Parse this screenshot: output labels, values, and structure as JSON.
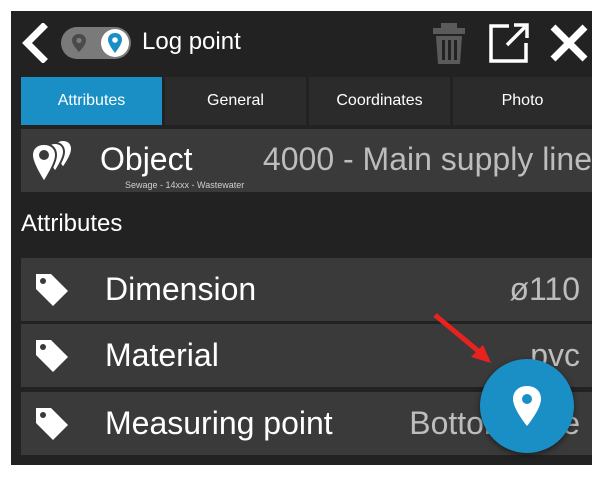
{
  "header": {
    "title": "Log point"
  },
  "tabs": [
    {
      "label": "Attributes",
      "active": true
    },
    {
      "label": "General",
      "active": false
    },
    {
      "label": "Coordinates",
      "active": false
    },
    {
      "label": "Photo",
      "active": false
    }
  ],
  "object": {
    "label": "Object",
    "value": "4000 - Main supply line",
    "subtitle": "Sewage - 14xxx - Wastewater"
  },
  "section": {
    "title": "Attributes"
  },
  "attributes": [
    {
      "label": "Dimension",
      "value": "ø110"
    },
    {
      "label": "Material",
      "value": "pvc"
    },
    {
      "label": "Measuring point",
      "value": "Bottom pipe"
    }
  ],
  "colors": {
    "accent": "#1a8fc6",
    "background": "#222222",
    "row": "#3a3a3a",
    "annotation_arrow": "#e8231f"
  },
  "icons": {
    "back": "chevron-left-icon",
    "mode_map": "map-pin-icon",
    "mode_location": "location-pin-icon",
    "delete": "trash-icon",
    "open_external": "external-link-icon",
    "close": "close-icon",
    "object": "multi-pin-icon",
    "attribute": "tag-icon",
    "fab": "location-pin-icon"
  }
}
